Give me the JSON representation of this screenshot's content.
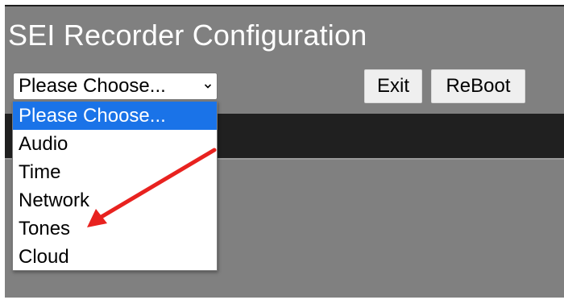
{
  "app": {
    "title": "SEI Recorder Configuration"
  },
  "select": {
    "value": "Please Choose...",
    "options": [
      "Please Choose...",
      "Audio",
      "Time",
      "Network",
      "Tones",
      "Cloud"
    ],
    "selected_index": 0
  },
  "buttons": {
    "exit_label": "Exit",
    "reboot_label": "ReBoot"
  },
  "icons": {
    "select_chevron": "chevron-down-icon",
    "annotation": "red-arrow-icon"
  },
  "colors": {
    "background": "#808080",
    "band": "#202020",
    "selected_option": "#1a73e8",
    "annotation_arrow": "#e8221f"
  }
}
